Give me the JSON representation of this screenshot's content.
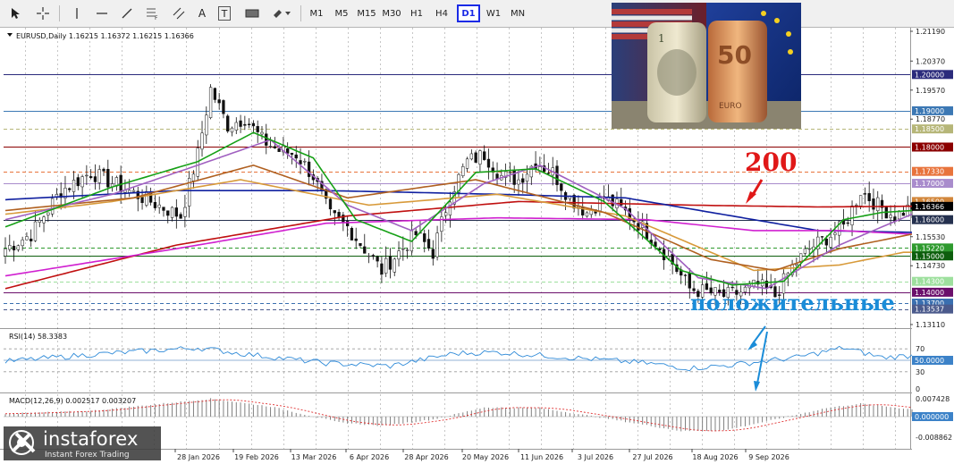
{
  "toolbar": {
    "tools": [
      {
        "name": "cursor-icon"
      },
      {
        "name": "crosshair-icon"
      },
      {
        "name": "vertical-line-icon"
      },
      {
        "name": "horizontal-line-icon"
      },
      {
        "name": "trendline-icon"
      },
      {
        "name": "fibonacci-icon"
      },
      {
        "name": "text-tool-icon",
        "label": "A"
      },
      {
        "name": "text-label-icon",
        "label": "T"
      },
      {
        "name": "rectangle-icon"
      },
      {
        "name": "shapes-dropdown-icon"
      }
    ],
    "timeframes": [
      "M1",
      "M5",
      "M15",
      "M30",
      "H1",
      "H4",
      "D1",
      "W1",
      "MN"
    ],
    "active_timeframe": "D1"
  },
  "chart_data": {
    "type": "line",
    "title": "EURUSD,Daily  1.16215 1.16372 1.16215 1.16366",
    "x_tick_labels": [
      "28 Jan 2026",
      "19 Feb 2026",
      "13 Mar 2026",
      "6 Apr 2026",
      "28 Apr 2026",
      "20 May 2026",
      "11 Jun 2026",
      "3 Jul 2026",
      "27 Jul 2026",
      "18 Aug 2026",
      "9 Sep 2026"
    ],
    "price_axis": {
      "ylim": [
        1.1311,
        1.2119
      ],
      "plain_labels": [
        "1.21190",
        "1.20370",
        "1.19570",
        "1.18770",
        "1.15530",
        "1.14730",
        "1.13110"
      ],
      "level_labels": [
        {
          "value": 1.2,
          "label": "1.20000",
          "color": "#2b2b7c"
        },
        {
          "value": 1.19,
          "label": "1.19000",
          "color": "#3c78b4"
        },
        {
          "value": 1.185,
          "label": "1.18500",
          "color": "#b6b678"
        },
        {
          "value": 1.18,
          "label": "1.18000",
          "color": "#8b0000"
        },
        {
          "value": 1.1733,
          "label": "1.17330",
          "color": "#e8743c"
        },
        {
          "value": 1.17,
          "label": "1.17000",
          "color": "#a98ccc"
        },
        {
          "value": 1.165,
          "label": "1.16500",
          "color": "#d2873c"
        },
        {
          "value": 1.16366,
          "label": "1.16366",
          "color": "#000000"
        },
        {
          "value": 1.16,
          "label": "1.16000",
          "color": "#24304e"
        },
        {
          "value": 1.1522,
          "label": "1.15220",
          "color": "#2e9a2e"
        },
        {
          "value": 1.15,
          "label": "1.15000",
          "color": "#0d5e0d"
        },
        {
          "value": 1.143,
          "label": "1.14300",
          "color": "#9ee09e"
        },
        {
          "value": 1.14,
          "label": "1.14000",
          "color": "#6b0f6b"
        },
        {
          "value": 1.137,
          "label": "1.13700",
          "color": "#3a6fb0"
        },
        {
          "value": 1.13537,
          "label": "1.13537",
          "color": "#4b5a8c"
        }
      ],
      "lines": [
        {
          "value": 1.2,
          "color": "#2b2b7c",
          "style": "solid"
        },
        {
          "value": 1.19,
          "color": "#3c78b4",
          "style": "solid"
        },
        {
          "value": 1.185,
          "color": "#b6b678",
          "style": "dash"
        },
        {
          "value": 1.18,
          "color": "#8b0000",
          "style": "solid"
        },
        {
          "value": 1.1733,
          "color": "#e8743c",
          "style": "dash"
        },
        {
          "value": 1.17,
          "color": "#a98ccc",
          "style": "solid"
        },
        {
          "value": 1.16,
          "color": "#24304e",
          "style": "solid"
        },
        {
          "value": 1.1522,
          "color": "#2e9a2e",
          "style": "dash"
        },
        {
          "value": 1.15,
          "color": "#0d5e0d",
          "style": "solid"
        },
        {
          "value": 1.143,
          "color": "#9ee09e",
          "style": "dash"
        },
        {
          "value": 1.14,
          "color": "#6b0f6b",
          "style": "solid"
        },
        {
          "value": 1.137,
          "color": "#3a6fb0",
          "style": "dash"
        },
        {
          "value": 1.13537,
          "color": "#4b5a8c",
          "style": "dash"
        }
      ]
    },
    "price_close_anchors": [
      [
        0,
        1.152
      ],
      [
        6,
        1.156
      ],
      [
        13,
        1.168
      ],
      [
        20,
        1.173
      ],
      [
        27,
        1.169
      ],
      [
        34,
        1.165
      ],
      [
        41,
        1.161
      ],
      [
        45,
        1.178
      ],
      [
        48,
        1.196
      ],
      [
        52,
        1.186
      ],
      [
        56,
        1.188
      ],
      [
        60,
        1.182
      ],
      [
        64,
        1.179
      ],
      [
        68,
        1.178
      ],
      [
        72,
        1.172
      ],
      [
        76,
        1.161
      ],
      [
        80,
        1.158
      ],
      [
        84,
        1.152
      ],
      [
        88,
        1.146
      ],
      [
        92,
        1.151
      ],
      [
        96,
        1.156
      ],
      [
        100,
        1.151
      ],
      [
        104,
        1.167
      ],
      [
        108,
        1.176
      ],
      [
        112,
        1.178
      ],
      [
        116,
        1.172
      ],
      [
        120,
        1.171
      ],
      [
        124,
        1.176
      ],
      [
        128,
        1.173
      ],
      [
        132,
        1.166
      ],
      [
        136,
        1.162
      ],
      [
        140,
        1.166
      ],
      [
        144,
        1.163
      ],
      [
        148,
        1.159
      ],
      [
        152,
        1.154
      ],
      [
        156,
        1.148
      ],
      [
        160,
        1.141
      ],
      [
        164,
        1.14
      ],
      [
        168,
        1.139
      ],
      [
        172,
        1.14
      ],
      [
        176,
        1.142
      ],
      [
        180,
        1.139
      ],
      [
        184,
        1.147
      ],
      [
        188,
        1.152
      ],
      [
        192,
        1.155
      ],
      [
        196,
        1.158
      ],
      [
        200,
        1.168
      ],
      [
        204,
        1.164
      ],
      [
        208,
        1.161
      ],
      [
        212,
        1.16366
      ]
    ],
    "moving_averages": [
      {
        "color": "#c01010",
        "anchors": [
          [
            0,
            1.141
          ],
          [
            40,
            1.153
          ],
          [
            80,
            1.161
          ],
          [
            120,
            1.165
          ],
          [
            160,
            1.164
          ],
          [
            190,
            1.1635
          ],
          [
            212,
            1.1637
          ]
        ]
      },
      {
        "color": "#1020a0",
        "anchors": [
          [
            0,
            1.1655
          ],
          [
            40,
            1.168
          ],
          [
            75,
            1.168
          ],
          [
            115,
            1.167
          ],
          [
            145,
            1.166
          ],
          [
            170,
            1.161
          ],
          [
            190,
            1.157
          ],
          [
            212,
            1.1565
          ]
        ]
      },
      {
        "color": "#d020d0",
        "anchors": [
          [
            0,
            1.1445
          ],
          [
            40,
            1.152
          ],
          [
            75,
            1.159
          ],
          [
            115,
            1.1605
          ],
          [
            150,
            1.16
          ],
          [
            175,
            1.157
          ],
          [
            195,
            1.157
          ],
          [
            212,
            1.156
          ]
        ]
      },
      {
        "color": "#d89a3a",
        "anchors": [
          [
            0,
            1.1615
          ],
          [
            25,
            1.165
          ],
          [
            55,
            1.171
          ],
          [
            85,
            1.164
          ],
          [
            115,
            1.167
          ],
          [
            145,
            1.161
          ],
          [
            175,
            1.146
          ],
          [
            195,
            1.1475
          ],
          [
            210,
            1.151
          ]
        ]
      },
      {
        "color": "#b06020",
        "anchors": [
          [
            0,
            1.1625
          ],
          [
            30,
            1.166
          ],
          [
            58,
            1.175
          ],
          [
            80,
            1.166
          ],
          [
            110,
            1.171
          ],
          [
            140,
            1.162
          ],
          [
            165,
            1.149
          ],
          [
            180,
            1.146
          ],
          [
            195,
            1.152
          ],
          [
            212,
            1.156
          ]
        ]
      },
      {
        "color": "#a060c0",
        "anchors": [
          [
            0,
            1.16
          ],
          [
            25,
            1.167
          ],
          [
            45,
            1.175
          ],
          [
            62,
            1.182
          ],
          [
            80,
            1.164
          ],
          [
            95,
            1.157
          ],
          [
            112,
            1.17
          ],
          [
            125,
            1.175
          ],
          [
            145,
            1.163
          ],
          [
            162,
            1.144
          ],
          [
            178,
            1.141
          ],
          [
            195,
            1.153
          ],
          [
            212,
            1.1615
          ]
        ]
      },
      {
        "color": "#16a016",
        "anchors": [
          [
            0,
            1.158
          ],
          [
            25,
            1.169
          ],
          [
            45,
            1.176
          ],
          [
            58,
            1.184
          ],
          [
            72,
            1.177
          ],
          [
            82,
            1.16
          ],
          [
            95,
            1.154
          ],
          [
            110,
            1.173
          ],
          [
            124,
            1.174
          ],
          [
            140,
            1.165
          ],
          [
            158,
            1.146
          ],
          [
            170,
            1.142
          ],
          [
            182,
            1.143
          ],
          [
            196,
            1.16
          ],
          [
            205,
            1.162
          ],
          [
            212,
            1.1625
          ]
        ]
      }
    ],
    "rsi": {
      "label": "RSI(14) 58.3383",
      "value": 58.3383,
      "ylim": [
        0,
        100
      ],
      "level_labels": [
        "70",
        "50",
        "30",
        "0"
      ],
      "badge": "50.0000"
    },
    "macd": {
      "label": "MACD(12,26,9) 0.002517 0.003207",
      "main": 0.002517,
      "signal": 0.003207,
      "tick_labels": [
        "0.007428",
        "-0.008862"
      ],
      "badge": "0.000000"
    },
    "annotations": [
      {
        "text": "200",
        "color": "#e01818"
      },
      {
        "text": "положительные",
        "color": "#1a8cd8"
      }
    ]
  },
  "watermark": {
    "name": "instaforex",
    "tagline": "Instant Forex Trading"
  }
}
